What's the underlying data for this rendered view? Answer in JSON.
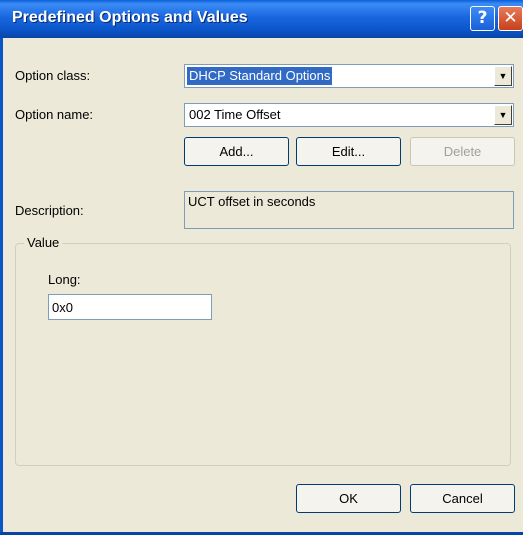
{
  "window": {
    "title": "Predefined Options and Values",
    "help_glyph": "?",
    "close_glyph": "✕"
  },
  "option_class": {
    "label": "Option class:",
    "value": "DHCP Standard Options"
  },
  "option_name": {
    "label": "Option name:",
    "value": "002 Time Offset"
  },
  "actions": {
    "add_label": "Add...",
    "edit_label": "Edit...",
    "delete_label": "Delete"
  },
  "description": {
    "label": "Description:",
    "value": "UCT offset in seconds"
  },
  "value_group": {
    "title": "Value",
    "long_label": "Long:",
    "long_value": "0x0"
  },
  "footer": {
    "ok_label": "OK",
    "cancel_label": "Cancel"
  },
  "icons": {
    "dropdown": "▼"
  }
}
